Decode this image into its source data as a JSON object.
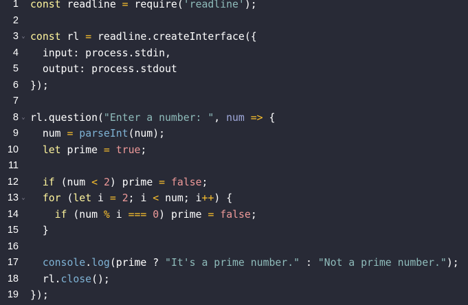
{
  "theme": {
    "background": "#282a36",
    "colors": {
      "kw": "#fff59d",
      "id": "#ffffff",
      "str": "#8fbcbb",
      "num": "#ef9a9a",
      "fn": "#7fb3d5",
      "param": "#9fa8da",
      "op": "#fbc02d",
      "plain": "#ffffff",
      "bool": "#ef9a9a"
    }
  },
  "editor": {
    "lines": [
      {
        "number": "1",
        "fold": false,
        "tokens": [
          [
            "kw",
            "const"
          ],
          [
            "plain",
            " readline "
          ],
          [
            "op",
            "="
          ],
          [
            "plain",
            " require("
          ],
          [
            "str",
            "'readline'"
          ],
          [
            "plain",
            ");"
          ]
        ]
      },
      {
        "number": "2",
        "fold": false,
        "tokens": []
      },
      {
        "number": "3",
        "fold": true,
        "tokens": [
          [
            "kw",
            "const"
          ],
          [
            "plain",
            " rl "
          ],
          [
            "op",
            "="
          ],
          [
            "plain",
            " readline.createInterface({"
          ]
        ]
      },
      {
        "number": "4",
        "fold": false,
        "tokens": [
          [
            "plain",
            "  input: process.stdin,"
          ]
        ]
      },
      {
        "number": "5",
        "fold": false,
        "tokens": [
          [
            "plain",
            "  output: process.stdout"
          ]
        ]
      },
      {
        "number": "6",
        "fold": false,
        "tokens": [
          [
            "plain",
            "});"
          ]
        ]
      },
      {
        "number": "7",
        "fold": false,
        "tokens": []
      },
      {
        "number": "8",
        "fold": true,
        "tokens": [
          [
            "plain",
            "rl.question("
          ],
          [
            "str",
            "\"Enter a number: \""
          ],
          [
            "plain",
            ", "
          ],
          [
            "param",
            "num"
          ],
          [
            "plain",
            " "
          ],
          [
            "op",
            "=>"
          ],
          [
            "plain",
            " {"
          ]
        ]
      },
      {
        "number": "9",
        "fold": false,
        "tokens": [
          [
            "plain",
            "  num "
          ],
          [
            "op",
            "="
          ],
          [
            "plain",
            " "
          ],
          [
            "fn",
            "parseInt"
          ],
          [
            "plain",
            "(num);"
          ]
        ]
      },
      {
        "number": "10",
        "fold": false,
        "tokens": [
          [
            "plain",
            "  "
          ],
          [
            "kw",
            "let"
          ],
          [
            "plain",
            " prime "
          ],
          [
            "op",
            "="
          ],
          [
            "plain",
            " "
          ],
          [
            "bool",
            "true"
          ],
          [
            "plain",
            ";"
          ]
        ]
      },
      {
        "number": "11",
        "fold": false,
        "tokens": []
      },
      {
        "number": "12",
        "fold": false,
        "tokens": [
          [
            "plain",
            "  "
          ],
          [
            "kw",
            "if"
          ],
          [
            "plain",
            " (num "
          ],
          [
            "op",
            "<"
          ],
          [
            "plain",
            " "
          ],
          [
            "num",
            "2"
          ],
          [
            "plain",
            ") prime "
          ],
          [
            "op",
            "="
          ],
          [
            "plain",
            " "
          ],
          [
            "bool",
            "false"
          ],
          [
            "plain",
            ";"
          ]
        ]
      },
      {
        "number": "13",
        "fold": true,
        "tokens": [
          [
            "plain",
            "  "
          ],
          [
            "kw",
            "for"
          ],
          [
            "plain",
            " ("
          ],
          [
            "kw",
            "let"
          ],
          [
            "plain",
            " i "
          ],
          [
            "op",
            "="
          ],
          [
            "plain",
            " "
          ],
          [
            "num",
            "2"
          ],
          [
            "plain",
            "; i "
          ],
          [
            "op",
            "<"
          ],
          [
            "plain",
            " num; i"
          ],
          [
            "op",
            "++"
          ],
          [
            "plain",
            ") {"
          ]
        ]
      },
      {
        "number": "14",
        "fold": false,
        "tokens": [
          [
            "plain",
            "    "
          ],
          [
            "kw",
            "if"
          ],
          [
            "plain",
            " (num "
          ],
          [
            "op",
            "%"
          ],
          [
            "plain",
            " i "
          ],
          [
            "op",
            "==="
          ],
          [
            "plain",
            " "
          ],
          [
            "num",
            "0"
          ],
          [
            "plain",
            ") prime "
          ],
          [
            "op",
            "="
          ],
          [
            "plain",
            " "
          ],
          [
            "bool",
            "false"
          ],
          [
            "plain",
            ";"
          ]
        ]
      },
      {
        "number": "15",
        "fold": false,
        "tokens": [
          [
            "plain",
            "  }"
          ]
        ]
      },
      {
        "number": "16",
        "fold": false,
        "tokens": []
      },
      {
        "number": "17",
        "fold": false,
        "tokens": [
          [
            "plain",
            "  "
          ],
          [
            "fn",
            "console"
          ],
          [
            "plain",
            "."
          ],
          [
            "fn",
            "log"
          ],
          [
            "plain",
            "(prime ? "
          ],
          [
            "str",
            "\"It's a prime number.\""
          ],
          [
            "plain",
            " : "
          ],
          [
            "str",
            "\"Not a prime number.\""
          ],
          [
            "plain",
            ");"
          ]
        ]
      },
      {
        "number": "18",
        "fold": false,
        "tokens": [
          [
            "plain",
            "  rl."
          ],
          [
            "fn",
            "close"
          ],
          [
            "plain",
            "();"
          ]
        ]
      },
      {
        "number": "19",
        "fold": false,
        "tokens": [
          [
            "plain",
            "});"
          ]
        ]
      }
    ]
  }
}
